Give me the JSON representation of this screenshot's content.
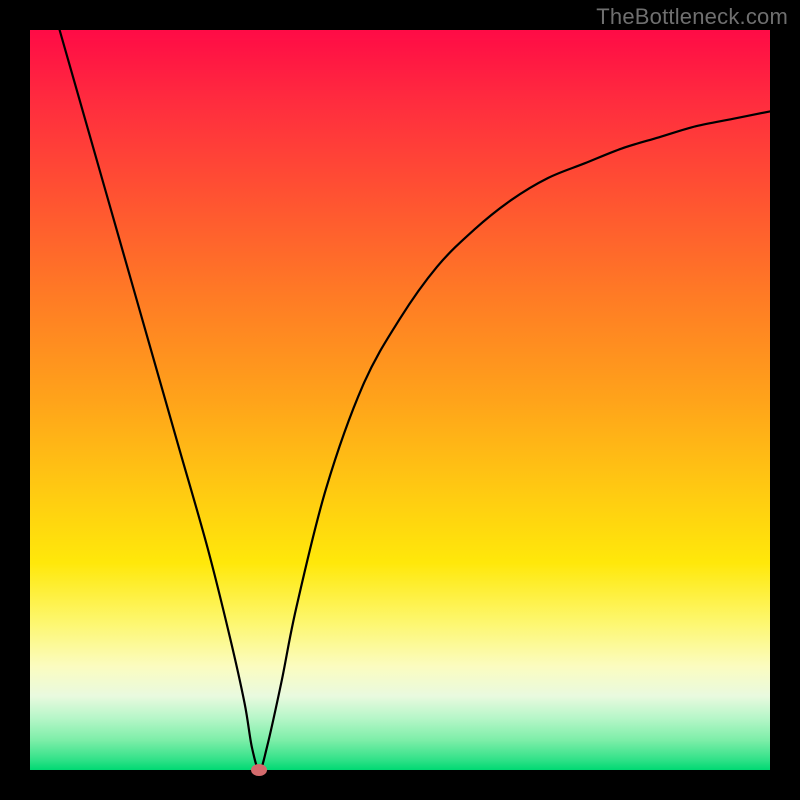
{
  "watermark": "TheBottleneck.com",
  "chart_data": {
    "type": "line",
    "title": "",
    "xlabel": "",
    "ylabel": "",
    "xlim": [
      0,
      100
    ],
    "ylim": [
      0,
      100
    ],
    "series": [
      {
        "name": "curve",
        "x": [
          4,
          8,
          12,
          16,
          20,
          24,
          27,
          29,
          30,
          31,
          32,
          34,
          36,
          40,
          45,
          50,
          55,
          60,
          65,
          70,
          75,
          80,
          85,
          90,
          95,
          100
        ],
        "y": [
          100,
          86,
          72,
          58,
          44,
          30,
          18,
          9,
          3,
          0,
          3,
          12,
          22,
          38,
          52,
          61,
          68,
          73,
          77,
          80,
          82,
          84,
          85.5,
          87,
          88,
          89
        ]
      }
    ],
    "marker": {
      "x": 31,
      "y": 0
    },
    "grid": false,
    "legend": false
  },
  "colors": {
    "curve": "#000000",
    "marker": "#d36a6c",
    "background_top": "#ff0b46",
    "background_bottom": "#00d973",
    "frame": "#000000",
    "watermark": "#6f6f6f"
  }
}
